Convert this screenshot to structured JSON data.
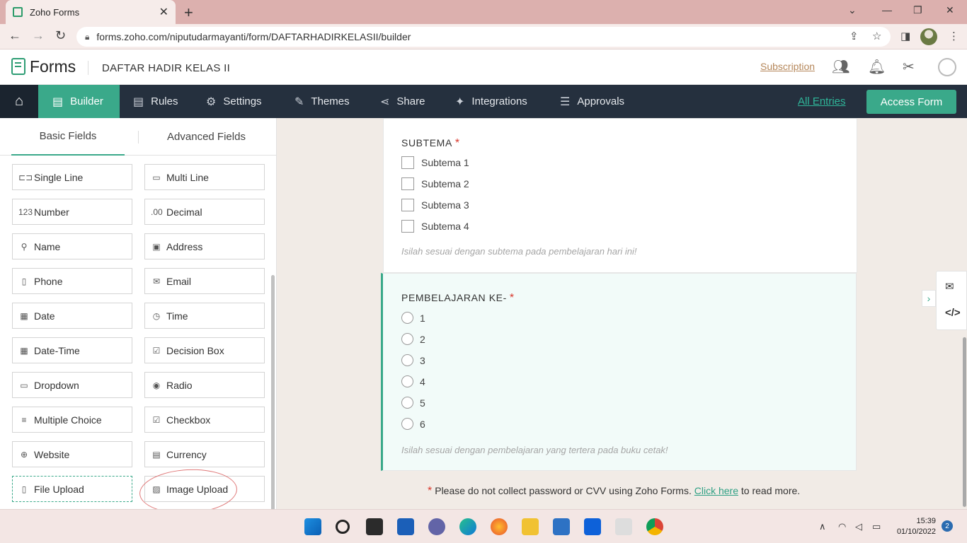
{
  "browser": {
    "tab_title": "Zoho Forms",
    "url": "forms.zoho.com/niputudarmayanti/form/DAFTARHADIRKELASII/builder"
  },
  "header": {
    "brand": "Forms",
    "form_name": "DAFTAR HADIR KELAS II",
    "subscription": "Subscription"
  },
  "nav": {
    "items": [
      {
        "label": "Builder",
        "icon": "builder-icon"
      },
      {
        "label": "Rules",
        "icon": "rules-icon"
      },
      {
        "label": "Settings",
        "icon": "gear-icon"
      },
      {
        "label": "Themes",
        "icon": "brush-icon"
      },
      {
        "label": "Share",
        "icon": "share-icon"
      },
      {
        "label": "Integrations",
        "icon": "puzzle-icon"
      },
      {
        "label": "Approvals",
        "icon": "approvals-icon"
      }
    ],
    "all_entries": "All Entries",
    "access_form": "Access Form"
  },
  "left_panel": {
    "tabs": [
      "Basic Fields",
      "Advanced Fields"
    ],
    "fields": [
      "Single Line",
      "Multi Line",
      "Number",
      "Decimal",
      "Name",
      "Address",
      "Phone",
      "Email",
      "Date",
      "Time",
      "Date-Time",
      "Decision Box",
      "Dropdown",
      "Radio",
      "Multiple Choice",
      "Checkbox",
      "Website",
      "Currency",
      "File Upload",
      "Image Upload"
    ],
    "field_icons": [
      "⊏⊐",
      "▭",
      "123",
      ".00",
      "⚲",
      "▣",
      "▯",
      "✉",
      "▦",
      "◷",
      "▦",
      "☑",
      "▭",
      "◉",
      "≡",
      "☑",
      "⊕",
      "▤",
      "▯",
      "▨"
    ]
  },
  "form": {
    "subtema": {
      "label": "SUBTEMA",
      "options": [
        "Subtema 1",
        "Subtema 2",
        "Subtema 3",
        "Subtema 4"
      ],
      "hint": "Isilah sesuai dengan subtema pada pembelajaran hari ini!"
    },
    "pembelajaran": {
      "label": "PEMBELAJARAN KE-",
      "options": [
        "1",
        "2",
        "3",
        "4",
        "5",
        "6"
      ],
      "hint": "Isilah sesuai dengan pembelajaran yang tertera pada buku cetak!"
    },
    "required_mark": "*",
    "notice_text": "Please do not collect password or CVV using Zoho Forms.",
    "notice_link": "Click here",
    "notice_tail": "to read more."
  },
  "taskbar": {
    "time": "15:39",
    "date": "01/10/2022",
    "notifications": "2"
  }
}
